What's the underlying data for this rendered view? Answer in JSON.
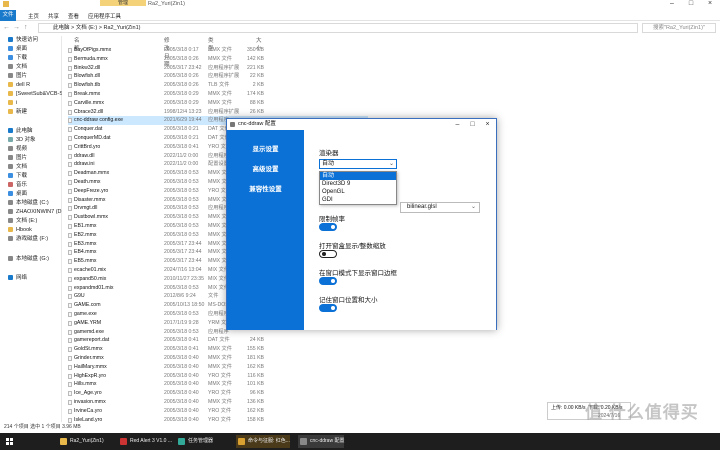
{
  "explorer": {
    "ribbon_manage": "管理",
    "window_title": "Ra2_Yuri(Zin1)",
    "ribbon_tabs": [
      "文件",
      "主页",
      "共享",
      "查看",
      "应用程序工具"
    ],
    "breadcrumb": [
      "此电脑",
      "文档 (E:)",
      "Ra2_Yuri(Zin1)"
    ],
    "search_placeholder": "搜索\"Ra2_Yuri(Zin1)\"",
    "nav": [
      "快速访问",
      "桌面",
      "下载",
      "文档",
      "图片",
      "dell R",
      "[SweetSub&VCB-Studio]",
      "i",
      "新建",
      "此电脑",
      "3D 对象",
      "视频",
      "图片",
      "文档",
      "下载",
      "音乐",
      "桌面",
      "本地磁盘 (C:)",
      "ZHAOXINWIN7 (D:)",
      "文档 (E:)",
      "Hbook",
      "游戏磁盘 (F:)",
      "本地磁盘 (G:)",
      "网络"
    ],
    "columns": [
      "名称",
      "修改日期",
      "类型",
      "大小"
    ],
    "files": [
      {
        "name": "BayOfPigs.mmx",
        "date": "2005/3/18 0:17",
        "type": "MMX 文件",
        "size": "350 KB"
      },
      {
        "name": "Bermuda.mmx",
        "date": "2005/3/18 0:26",
        "type": "MMX 文件",
        "size": "142 KB"
      },
      {
        "name": "Binkw32.dll",
        "date": "2005/3/17 23:42",
        "type": "应用程序扩展",
        "size": "221 KB"
      },
      {
        "name": "Blowfish.dll",
        "date": "2005/3/18 0:26",
        "type": "应用程序扩展",
        "size": "22 KB"
      },
      {
        "name": "Blowfish.tlb",
        "date": "2005/3/18 0:26",
        "type": "TLB 文件",
        "size": "2 KB"
      },
      {
        "name": "Break.mmx",
        "date": "2005/3/18 0:29",
        "type": "MMX 文件",
        "size": "174 KB"
      },
      {
        "name": "Carville.mmx",
        "date": "2005/3/18 0:29",
        "type": "MMX 文件",
        "size": "88 KB"
      },
      {
        "name": "Cbrace32.dll",
        "date": "1998/12/4 13:23",
        "type": "应用程序扩展",
        "size": "26 KB"
      },
      {
        "name": "cnc-ddraw config.exe",
        "date": "2021/6/29 19:44",
        "type": "应用程序",
        "size": "",
        "selected": true
      },
      {
        "name": "Conquer.dat",
        "date": "2005/3/18 0:21",
        "type": "DAT 文件",
        "size": ""
      },
      {
        "name": "ConquerMD.dat",
        "date": "2005/3/18 0:21",
        "type": "DAT 文件",
        "size": ""
      },
      {
        "name": "CrittBrd.yro",
        "date": "2005/3/18 0:41",
        "type": "YRO 文件",
        "size": ""
      },
      {
        "name": "ddraw.dll",
        "date": "2022/11/2 0:00",
        "type": "应用程序扩展",
        "size": ""
      },
      {
        "name": "ddraw.ini",
        "date": "2022/11/2 0:00",
        "type": "配置设置",
        "size": ""
      },
      {
        "name": "Deadman.mmx",
        "date": "2005/3/18 0:53",
        "type": "MMX 文件",
        "size": ""
      },
      {
        "name": "Death.mmx",
        "date": "2005/3/18 0:53",
        "type": "MMX 文件",
        "size": ""
      },
      {
        "name": "DeepFreze.yro",
        "date": "2005/3/18 0:53",
        "type": "YRO 文件",
        "size": ""
      },
      {
        "name": "Disaster.mmx",
        "date": "2005/3/18 0:53",
        "type": "MMX 文件",
        "size": ""
      },
      {
        "name": "Drvmgt.dll",
        "date": "2005/3/18 0:53",
        "type": "应用程序扩展",
        "size": ""
      },
      {
        "name": "Dustbowl.mmx",
        "date": "2005/3/18 0:53",
        "type": "MMX 文件",
        "size": ""
      },
      {
        "name": "EB1.mmx",
        "date": "2005/3/18 0:53",
        "type": "MMX 文件",
        "size": ""
      },
      {
        "name": "EB2.mmx",
        "date": "2005/3/18 0:53",
        "type": "MMX 文件",
        "size": ""
      },
      {
        "name": "EB3.mmx",
        "date": "2005/3/17 23:44",
        "type": "MMX 文件",
        "size": ""
      },
      {
        "name": "EB4.mmx",
        "date": "2005/3/17 23:44",
        "type": "MMX 文件",
        "size": ""
      },
      {
        "name": "EB5.mmx",
        "date": "2005/3/17 23:44",
        "type": "MMX 文件",
        "size": ""
      },
      {
        "name": "ecache01.mix",
        "date": "2024/7/16 13:04",
        "type": "MIX 文件",
        "size": ""
      },
      {
        "name": "expand50.mix",
        "date": "2010/11/27 23:35",
        "type": "MIX 文件",
        "size": ""
      },
      {
        "name": "expandmd01.mix",
        "date": "2005/3/18 0:53",
        "type": "MIX 文件",
        "size": ""
      },
      {
        "name": "G9U",
        "date": "2012/8/6 9:24",
        "type": "文件",
        "size": ""
      },
      {
        "name": "GAME.com",
        "date": "2005/10/13 18:50",
        "type": "MS-DOS 应用程序",
        "size": ""
      },
      {
        "name": "game.exe",
        "date": "2005/3/18 0:53",
        "type": "应用程序",
        "size": ""
      },
      {
        "name": "gAME.YRM",
        "date": "2017/1/19 9:28",
        "type": "YRM 文件",
        "size": ""
      },
      {
        "name": "gamemd.exe",
        "date": "2005/3/18 0:53",
        "type": "应用程序",
        "size": ""
      },
      {
        "name": "gamereport.dat",
        "date": "2005/3/18 0:41",
        "type": "DAT 文件",
        "size": "24 KB"
      },
      {
        "name": "GoldSt.mmx",
        "date": "2005/3/18 0:41",
        "type": "MMX 文件",
        "size": "155 KB"
      },
      {
        "name": "Grinder.mmx",
        "date": "2005/3/18 0:40",
        "type": "MMX 文件",
        "size": "181 KB"
      },
      {
        "name": "HailMary.mmx",
        "date": "2005/3/18 0:40",
        "type": "MMX 文件",
        "size": "162 KB"
      },
      {
        "name": "HighExpR.yro",
        "date": "2005/3/18 0:40",
        "type": "YRO 文件",
        "size": "116 KB"
      },
      {
        "name": "Hills.mmx",
        "date": "2005/3/18 0:40",
        "type": "MMX 文件",
        "size": "101 KB"
      },
      {
        "name": "Ice_Age.yro",
        "date": "2005/3/18 0:40",
        "type": "YRO 文件",
        "size": "96 KB"
      },
      {
        "name": "invasion.mmx",
        "date": "2005/3/18 0:40",
        "type": "MMX 文件",
        "size": "136 KB"
      },
      {
        "name": "IrvineCa.yro",
        "date": "2005/3/18 0:40",
        "type": "YRO 文件",
        "size": "162 KB"
      },
      {
        "name": "IsleLand.yro",
        "date": "2005/3/18 0:40",
        "type": "YRO 文件",
        "size": "158 KB"
      }
    ],
    "status": "214 个项目    选中 1 个项目 3.96 MB"
  },
  "dialog": {
    "title": "cnc-ddraw 配置",
    "tabs": [
      "显示设置",
      "高级设置",
      "兼容性设置"
    ],
    "renderer_label": "渲染器",
    "renderer_value": "自动",
    "renderer_options": [
      "自动",
      "Direct3D 9",
      "OpenGL",
      "GDI"
    ],
    "shader_value": "bilinear.glsl",
    "toggles": [
      {
        "label": "限制帧率",
        "on": true
      },
      {
        "label": "打开窗盒显示/整数缩放",
        "on": false
      },
      {
        "label": "在窗口模式下显示窗口边框",
        "on": true
      },
      {
        "label": "记住窗口位置和大小",
        "on": true
      }
    ]
  },
  "network": {
    "up": "上传: 0.00 KB/s",
    "down": "下载: 0.20 KB/s",
    "date": "2024/7/16"
  },
  "watermark": "值 什么值得买",
  "taskbar": {
    "items": [
      "Ra2_Yuri(Zin1)",
      "Red Alert 3 V1.0 ...",
      "任务管理器",
      "命令与征服: 红色...",
      "cnc-ddraw 配置"
    ],
    "colors": {
      "bg": "#1e1e1e",
      "accent": "#0b71d6"
    }
  }
}
